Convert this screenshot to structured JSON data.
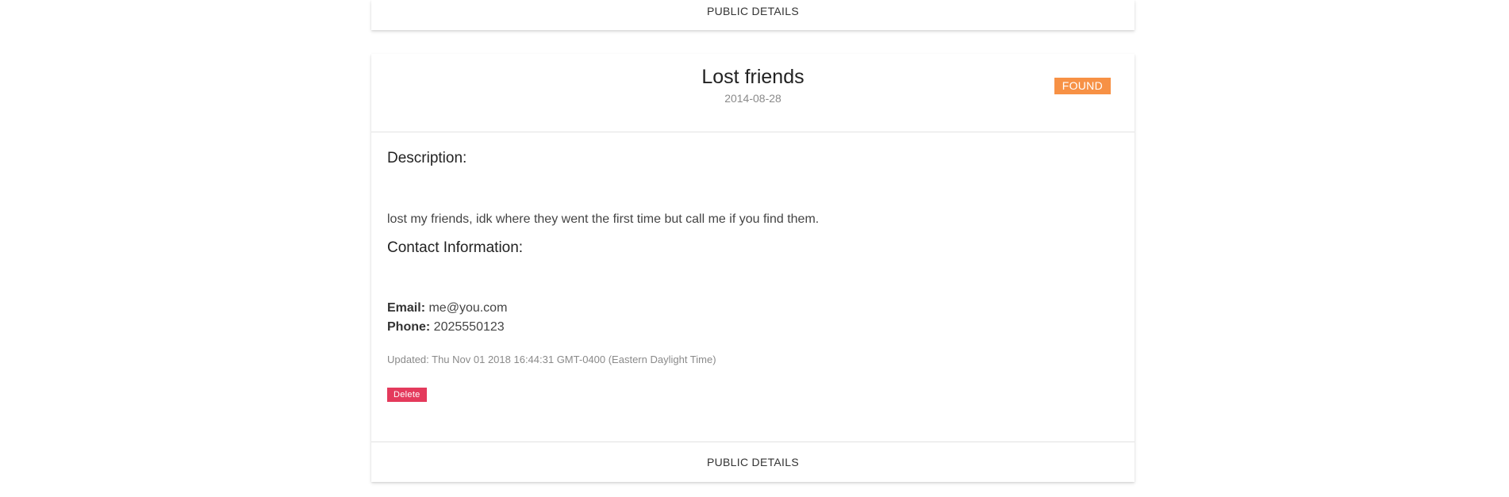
{
  "top_card": {
    "footer_link": "PUBLIC DETAILS"
  },
  "item": {
    "title": "Lost friends",
    "date": "2014-08-28",
    "status_badge": "FOUND",
    "description_heading": "Description:",
    "description_text": "lost my friends, idk where they went the first time but call me if you find them.",
    "contact_heading": "Contact Information:",
    "email_label": "Email:",
    "email_value": "me@you.com",
    "phone_label": "Phone:",
    "phone_value": "2025550123",
    "updated_text": "Updated: Thu Nov 01 2018 16:44:31 GMT-0400 (Eastern Daylight Time)",
    "delete_label": "Delete",
    "footer_link": "PUBLIC DETAILS"
  },
  "colors": {
    "badge_found": "#f79145",
    "delete_button": "#e43a5c"
  }
}
